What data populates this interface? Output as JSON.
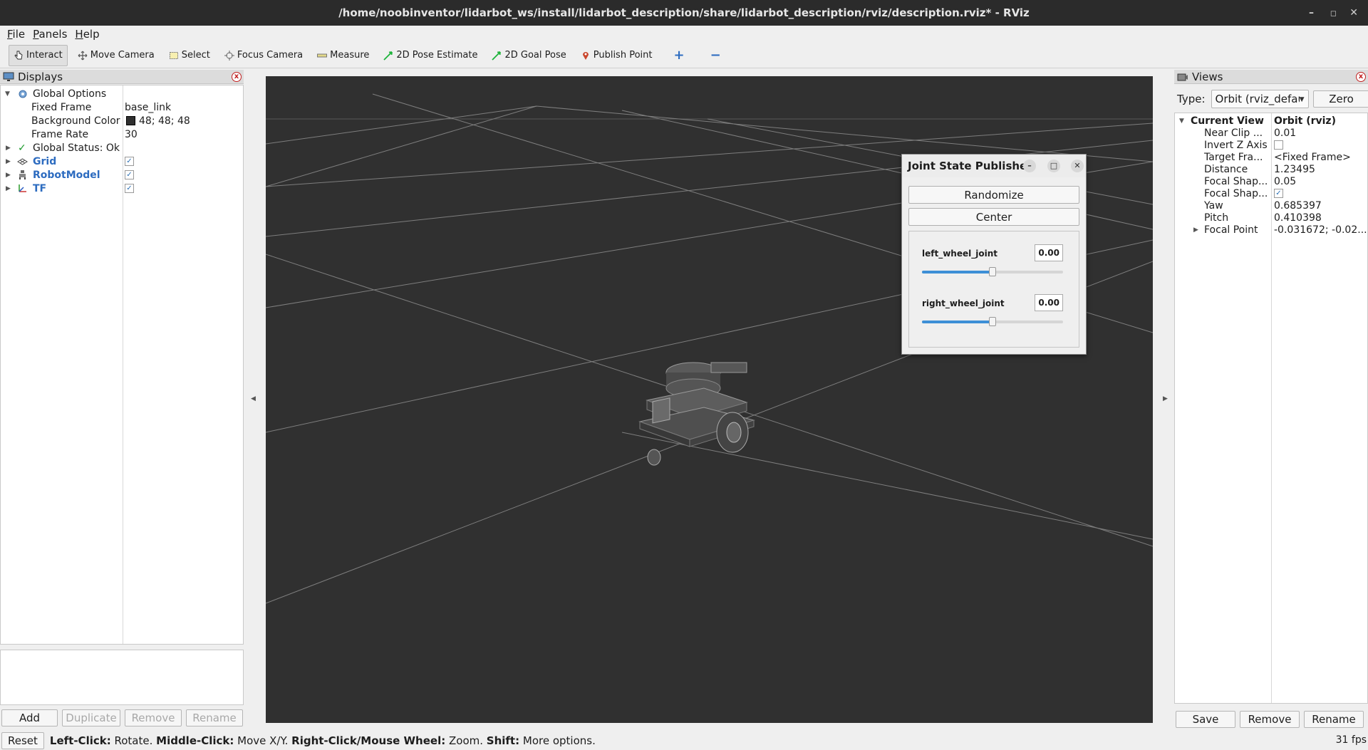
{
  "window": {
    "title": "/home/noobinventor/lidarbot_ws/install/lidarbot_description/share/lidarbot_description/rviz/description.rviz* - RViz",
    "minimize": "–",
    "maximize": "◻",
    "close": "✕"
  },
  "menu": [
    "File",
    "Panels",
    "Help"
  ],
  "toolbar": {
    "interact": "Interact",
    "move_camera": "Move Camera",
    "select": "Select",
    "focus_camera": "Focus Camera",
    "measure": "Measure",
    "pose_estimate": "2D Pose Estimate",
    "goal_pose": "2D Goal Pose",
    "publish_point": "Publish Point",
    "add_tool": "+",
    "remove_tool": "−"
  },
  "displays": {
    "title": "Displays",
    "close": "x",
    "global_options": "Global Options",
    "fixed_frame_label": "Fixed Frame",
    "fixed_frame_value": "base_link",
    "background_color_label": "Background Color",
    "background_color_value": "48; 48; 48",
    "background_color_swatch": "#303030",
    "frame_rate_label": "Frame Rate",
    "frame_rate_value": "30",
    "global_status": "Global Status: Ok",
    "items": [
      {
        "label": "Grid",
        "checked": true,
        "icon": "grid-icon"
      },
      {
        "label": "RobotModel",
        "checked": true,
        "icon": "robot-icon"
      },
      {
        "label": "TF",
        "checked": true,
        "icon": "axes-icon"
      }
    ],
    "check_mark": "✓",
    "buttons": {
      "add": "Add",
      "duplicate": "Duplicate",
      "remove": "Remove",
      "rename": "Rename"
    }
  },
  "jsp": {
    "title": "Joint State Publisher",
    "min": "–",
    "max": "□",
    "close": "✕",
    "randomize": "Randomize",
    "center": "Center",
    "joints": [
      {
        "name": "left_wheel_joint",
        "value": "0.00",
        "slider_fraction": 0.5
      },
      {
        "name": "right_wheel_joint",
        "value": "0.00",
        "slider_fraction": 0.5
      }
    ]
  },
  "views": {
    "title": "Views",
    "close": "x",
    "type_label": "Type:",
    "type_value": "Orbit (rviz_defau",
    "zero": "Zero",
    "current_view": "Current View",
    "current_view_value": "Orbit (rviz)",
    "props": [
      {
        "label": "Near Clip ...",
        "value": "0.01"
      },
      {
        "label": "Invert Z Axis",
        "value": ""
      },
      {
        "label": "Target Fra...",
        "value": "<Fixed Frame>"
      },
      {
        "label": "Distance",
        "value": "1.23495"
      },
      {
        "label": "Focal Shap...",
        "value": "0.05"
      },
      {
        "label": "Focal Shap...",
        "value": "✓"
      },
      {
        "label": "Yaw",
        "value": "0.685397"
      },
      {
        "label": "Pitch",
        "value": "0.410398"
      },
      {
        "label": "Focal Point",
        "value": "-0.031672; -0.02..."
      }
    ],
    "buttons": {
      "save": "Save",
      "remove": "Remove",
      "rename": "Rename"
    }
  },
  "status": {
    "reset": "Reset",
    "left_click": "Left-Click:",
    "left_click_action": " Rotate. ",
    "middle_click": "Middle-Click:",
    "middle_click_action": " Move X/Y. ",
    "right_click": "Right-Click/Mouse Wheel:",
    "right_click_action": " Zoom. ",
    "shift": "Shift:",
    "shift_action": " More options.",
    "fps": "31 fps"
  },
  "colors": {
    "render_background": "#303030",
    "grid_line": "#8c8c8c",
    "accent_blue": "#2d6cc0",
    "slider_fill": "#3d8fd6"
  }
}
